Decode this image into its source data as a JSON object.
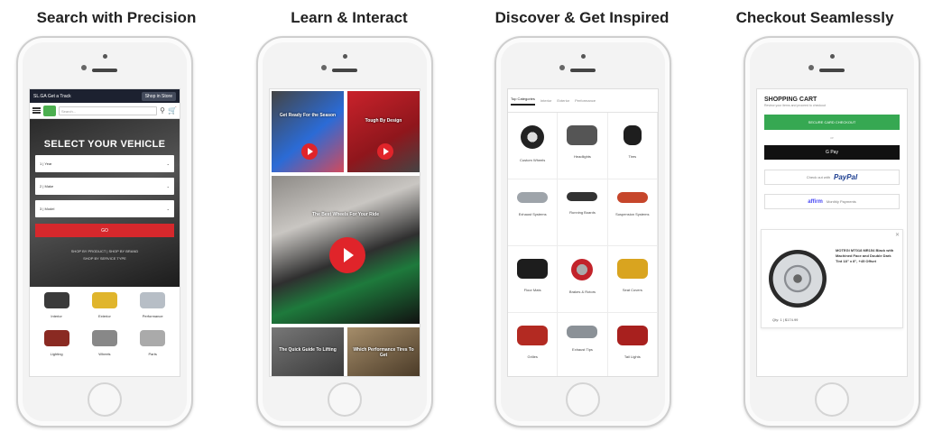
{
  "columns": [
    {
      "title": "Search with Precision"
    },
    {
      "title": "Learn & Interact"
    },
    {
      "title": "Discover & Get Inspired"
    },
    {
      "title": "Checkout Seamlessly"
    }
  ],
  "phone1": {
    "topbar_left": "SL.GA  Get a Track",
    "topbar_right": "Shop in Store",
    "search_placeholder": "Search...",
    "hero_title": "SELECT YOUR VEHICLE",
    "selects": [
      "1 | Year",
      "2 | Make",
      "3 | Model"
    ],
    "go_label": "GO",
    "links_line1": "SHOP BY PRODUCT  |  SHOP BY BRAND",
    "links_line2": "SHOP BY SERVICE TYPE",
    "categories": [
      "Interior",
      "Exterior",
      "Performance",
      "Lighting",
      "Wheels",
      "Parts"
    ]
  },
  "phone2": {
    "videos": [
      "Get Ready For the Season",
      "Tough By Design",
      "The Best Wheels For Your Ride",
      "The Quick Guide To Lifting",
      "Which Performance Tires To Get"
    ]
  },
  "phone3": {
    "tabs": [
      "Top Categories",
      "Interior",
      "Exterior",
      "Performance"
    ],
    "categories": [
      "Custom Wheels",
      "Headlights",
      "Tires",
      "Exhaust Systems",
      "Running Boards",
      "Suspension Systems",
      "Floor Mats",
      "Brakes & Rotors",
      "Seat Covers",
      "Grilles",
      "Exhaust Tips",
      "Tail Lights"
    ]
  },
  "phone4": {
    "title": "SHOPPING CART",
    "subtitle": "Review your items and proceed to checkout",
    "checkout_label": "SECURE CARD CHECKOUT",
    "or_label": "or",
    "gpay_label": "G Pay",
    "paypal_prefix": "Check out with",
    "paypal_label": "PayPal",
    "affirm_label": "affirm",
    "affirm_suffix": "Monthly Payments",
    "item_desc": "MOTEGI MT018 MR154 Black with Machined Face and Double Dark Tint 18\" x 8\", +45 Offset",
    "item_qty": "Qty: 1 | $174.99"
  },
  "colors": {
    "accent_red": "#d6282c",
    "checkout_green": "#36a852",
    "paypal_blue": "#1a3c8f"
  }
}
